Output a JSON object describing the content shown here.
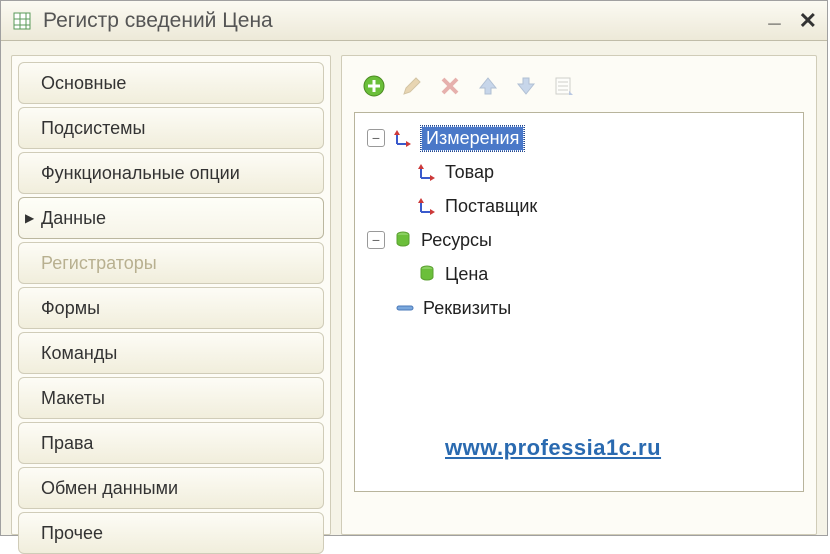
{
  "window": {
    "title": "Регистр сведений Цена"
  },
  "sidebar": {
    "tabs": [
      {
        "label": "Основные"
      },
      {
        "label": "Подсистемы"
      },
      {
        "label": "Функциональные опции"
      },
      {
        "label": "Данные"
      },
      {
        "label": "Регистраторы"
      },
      {
        "label": "Формы"
      },
      {
        "label": "Команды"
      },
      {
        "label": "Макеты"
      },
      {
        "label": "Права"
      },
      {
        "label": "Обмен данными"
      },
      {
        "label": "Прочее"
      }
    ],
    "active_index": 3,
    "disabled_index": 4
  },
  "toolbar": {
    "add_name": "add-icon",
    "edit_name": "pencil-icon",
    "delete_name": "delete-icon",
    "up_name": "arrow-up-icon",
    "down_name": "arrow-down-icon",
    "list_name": "list-icon"
  },
  "tree": {
    "dimensions": {
      "label": "Измерения",
      "expanded": true,
      "selected": true
    },
    "dim_children": [
      {
        "label": "Товар"
      },
      {
        "label": "Поставщик"
      }
    ],
    "resources": {
      "label": "Ресурсы",
      "expanded": true
    },
    "res_children": [
      {
        "label": "Цена"
      }
    ],
    "attributes": {
      "label": "Реквизиты"
    }
  },
  "watermark": "www.professia1c.ru"
}
